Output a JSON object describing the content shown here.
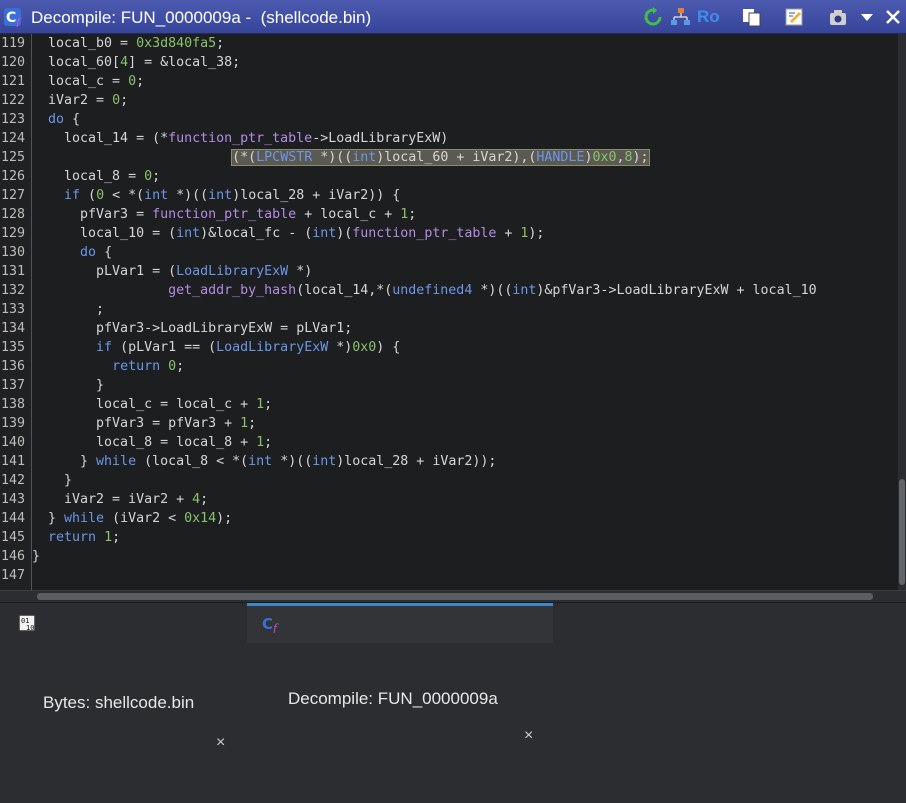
{
  "window": {
    "title": "Decompile: FUN_0000009a -  (shellcode.bin)",
    "toolbar_text_ro": "Ro"
  },
  "code": {
    "lines": [
      {
        "n": "119",
        "text": "  local_b0 = 0x3d840fa5;"
      },
      {
        "n": "120",
        "text": "  local_60[4] = &local_38;"
      },
      {
        "n": "121",
        "text": "  local_c = 0;"
      },
      {
        "n": "122",
        "text": "  iVar2 = 0;"
      },
      {
        "n": "123",
        "text": "  do {"
      },
      {
        "n": "124",
        "text": "    local_14 = (*function_ptr_table->LoadLibraryExW)"
      },
      {
        "n": "125",
        "text": "                         (*(LPCWSTR *)((int)local_60 + iVar2),(HANDLE)0x0,8);"
      },
      {
        "n": "126",
        "text": "    local_8 = 0;"
      },
      {
        "n": "127",
        "text": "    if (0 < *(int *)((int)local_28 + iVar2)) {"
      },
      {
        "n": "128",
        "text": "      pfVar3 = function_ptr_table + local_c + 1;"
      },
      {
        "n": "129",
        "text": "      local_10 = (int)&local_fc - (int)(function_ptr_table + 1);"
      },
      {
        "n": "130",
        "text": "      do {"
      },
      {
        "n": "131",
        "text": "        pLVar1 = (LoadLibraryExW *)"
      },
      {
        "n": "132",
        "text": "                 get_addr_by_hash(local_14,*(undefined4 *)((int)&pfVar3->LoadLibraryExW + local_10"
      },
      {
        "n": "133",
        "text": "        ;"
      },
      {
        "n": "134",
        "text": "        pfVar3->LoadLibraryExW = pLVar1;"
      },
      {
        "n": "135",
        "text": "        if (pLVar1 == (LoadLibraryExW *)0x0) {"
      },
      {
        "n": "136",
        "text": "          return 0;"
      },
      {
        "n": "137",
        "text": "        }"
      },
      {
        "n": "138",
        "text": "        local_c = local_c + 1;"
      },
      {
        "n": "139",
        "text": "        pfVar3 = pfVar3 + 1;"
      },
      {
        "n": "140",
        "text": "        local_8 = local_8 + 1;"
      },
      {
        "n": "141",
        "text": "      } while (local_8 < *(int *)((int)local_28 + iVar2));"
      },
      {
        "n": "142",
        "text": "    }"
      },
      {
        "n": "143",
        "text": "    iVar2 = iVar2 + 4;"
      },
      {
        "n": "144",
        "text": "  } while (iVar2 < 0x14);"
      },
      {
        "n": "145",
        "text": "  return 1;"
      },
      {
        "n": "146",
        "text": "}"
      },
      {
        "n": "147",
        "text": ""
      }
    ]
  },
  "tabs": [
    {
      "label": "Bytes: shellcode.bin",
      "close": "×"
    },
    {
      "label": "Decompile: FUN_0000009a",
      "close": "×"
    }
  ],
  "icons": {
    "title": "decompile-icon",
    "refresh": "refresh-icon",
    "graph": "function-graph-icon",
    "copy": "copy-icon",
    "edit": "edit-icon",
    "snapshot": "snapshot-icon",
    "menu": "chevron-down-icon",
    "close": "close-icon",
    "bytes_tab": "bytes-icon",
    "decompile_tab": "decompile-icon"
  },
  "colors": {
    "title_bar": "#3f4ea8",
    "editor_bg": "#1d1e20",
    "keyword": "#6d96e9",
    "function": "#b38ce3",
    "number": "#88c46b",
    "highlight": "#5a5a52",
    "active_tab_accent": "#3d86c9"
  }
}
